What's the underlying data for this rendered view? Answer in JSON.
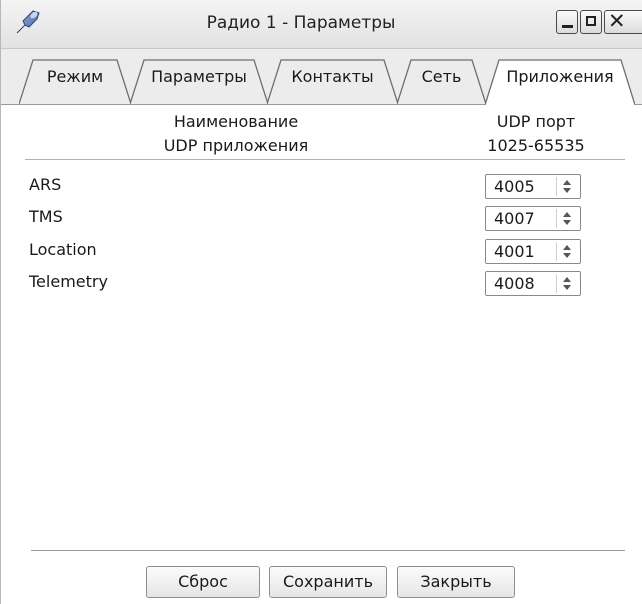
{
  "window": {
    "title": "Радио 1 - Параметры"
  },
  "tabs": [
    {
      "label": "Режим",
      "active": false
    },
    {
      "label": "Параметры",
      "active": false
    },
    {
      "label": "Контакты",
      "active": false
    },
    {
      "label": "Сеть",
      "active": false
    },
    {
      "label": "Приложения",
      "active": true
    }
  ],
  "table": {
    "col_name_line1": "Наименование",
    "col_name_line2": "UDP приложения",
    "col_port_line1": "UDP порт",
    "col_port_line2": "1025-65535",
    "rows": [
      {
        "name": "ARS",
        "port": "4005"
      },
      {
        "name": "TMS",
        "port": "4007"
      },
      {
        "name": "Location",
        "port": "4001"
      },
      {
        "name": "Telemetry",
        "port": "4008"
      }
    ]
  },
  "buttons": {
    "reset": "Сброс",
    "save": "Сохранить",
    "close": "Закрыть"
  },
  "icons": {
    "app": "radio-antenna-icon",
    "minimize": "minimize-icon",
    "maximize": "maximize-icon",
    "close": "close-icon",
    "spin": "spin-arrows-icon"
  }
}
